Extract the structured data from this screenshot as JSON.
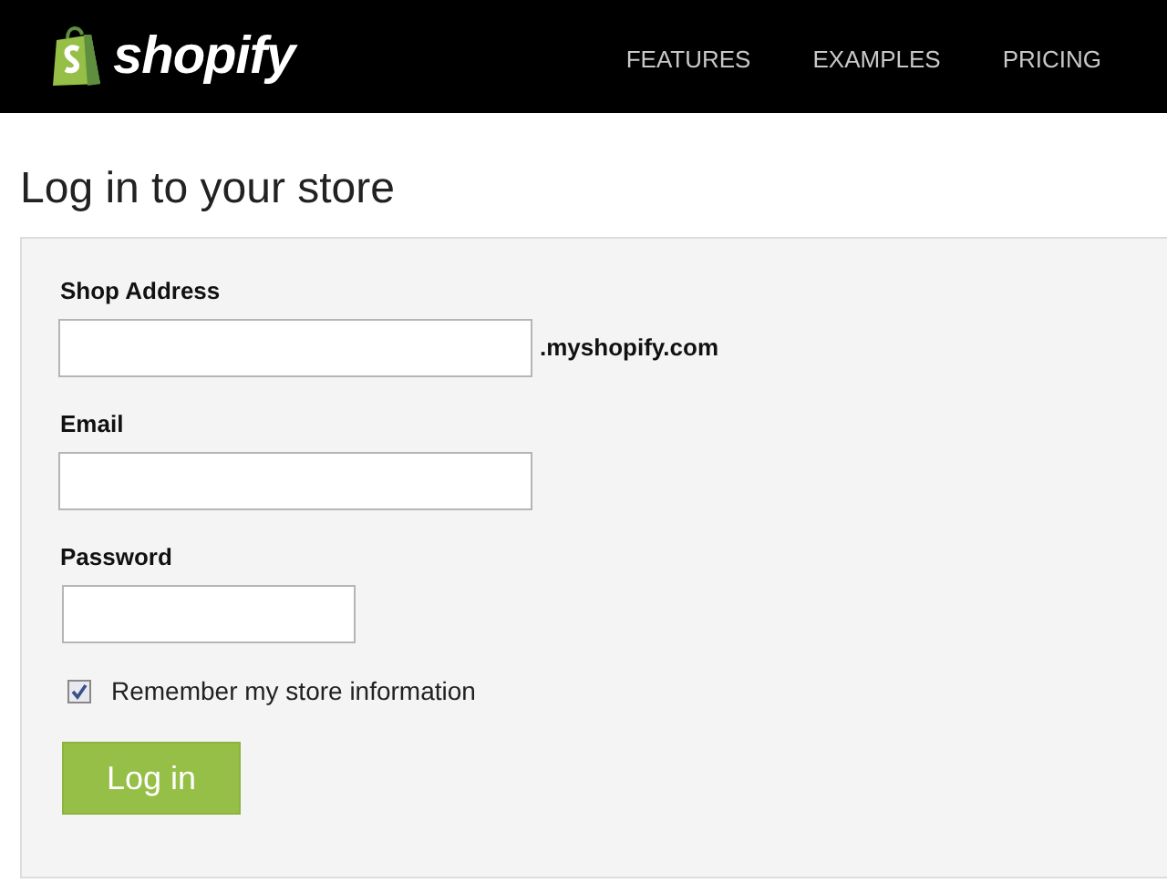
{
  "header": {
    "logo_text": "shopify",
    "nav": [
      "FEATURES",
      "EXAMPLES",
      "PRICING"
    ]
  },
  "page_title": "Log in to your store",
  "form": {
    "fields": [
      {
        "label": "Shop Address",
        "kind": "wide",
        "suffix": ".myshopify.com"
      },
      {
        "label": "Email",
        "kind": "wide"
      },
      {
        "label": "Password",
        "kind": "narrow"
      }
    ],
    "remember": {
      "label": "Remember my store information",
      "checked": true
    },
    "submit": "Log in"
  }
}
